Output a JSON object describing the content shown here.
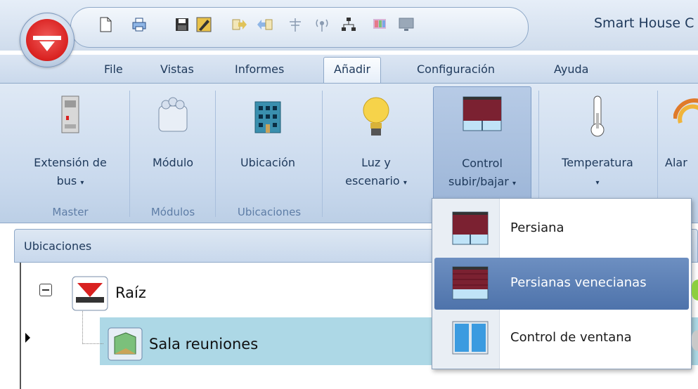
{
  "app": {
    "title": "Smart House C"
  },
  "quick_access": {
    "icons": [
      "new-document-icon",
      "print-icon",
      "save-icon",
      "edit-icon",
      "import-icon",
      "export-icon",
      "antenna-icon",
      "wireless-icon",
      "network-icon",
      "palette-icon",
      "monitor-icon"
    ]
  },
  "tabs": [
    {
      "label": "File"
    },
    {
      "label": "Vistas"
    },
    {
      "label": "Informes"
    },
    {
      "label": "Añadir",
      "active": true
    },
    {
      "label": "Configuración"
    },
    {
      "label": "Ayuda"
    }
  ],
  "ribbon": {
    "buttons": [
      {
        "label": "Extensión de",
        "label2": "bus",
        "dropdown": true
      },
      {
        "label": "Módulo"
      },
      {
        "label": "Ubicación"
      },
      {
        "label": "Luz y",
        "label2": "escenario",
        "dropdown": true
      },
      {
        "label": "Control",
        "label2": "subir/bajar",
        "dropdown": true,
        "pressed": true
      },
      {
        "label": "Temperatura",
        "dropdown": true
      },
      {
        "label": "Alar"
      }
    ],
    "groups": [
      "Master",
      "Módulos",
      "Ubicaciones"
    ]
  },
  "dropdown": {
    "items": [
      {
        "label": "Persiana"
      },
      {
        "label": "Persianas venecianas",
        "highlighted": true
      },
      {
        "label": "Control de ventana"
      }
    ]
  },
  "panel": {
    "title": "Ubicaciones"
  },
  "tree": {
    "root": {
      "label": "Raíz"
    },
    "child": {
      "label": "Sala reuniones",
      "selected": true
    }
  },
  "colors": {
    "accent": "#4e73ab",
    "selection": "#add8e6",
    "brand_red": "#d92120"
  }
}
